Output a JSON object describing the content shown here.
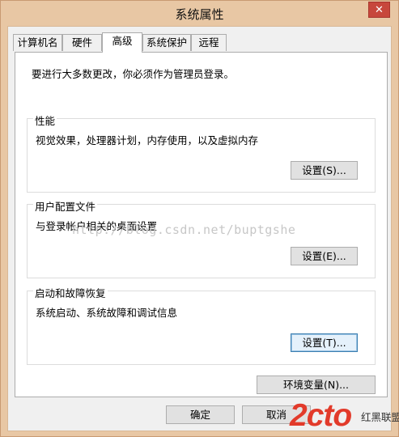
{
  "window": {
    "title": "系统属性",
    "close_glyph": "✕"
  },
  "tabs": [
    {
      "label": "计算机名"
    },
    {
      "label": "硬件"
    },
    {
      "label": "高级"
    },
    {
      "label": "系统保护"
    },
    {
      "label": "远程"
    }
  ],
  "panel": {
    "notice": "要进行大多数更改，你必须作为管理员登录。",
    "groups": [
      {
        "title": "性能",
        "desc": "视觉效果，处理器计划，内存使用，以及虚拟内存",
        "button": "设置(S)..."
      },
      {
        "title": "用户配置文件",
        "desc": "与登录帐户相关的桌面设置",
        "button": "设置(E)..."
      },
      {
        "title": "启动和故障恢复",
        "desc": "系统启动、系统故障和调试信息",
        "button": "设置(T)..."
      }
    ],
    "env_button": "环境变量(N)..."
  },
  "footer": {
    "ok": "确定",
    "cancel": "取消"
  },
  "watermark": {
    "text": "http://blog.csdn.net/buptgshe"
  },
  "site_logo": {
    "brand": "2cto",
    "text": "红黑联盟"
  }
}
